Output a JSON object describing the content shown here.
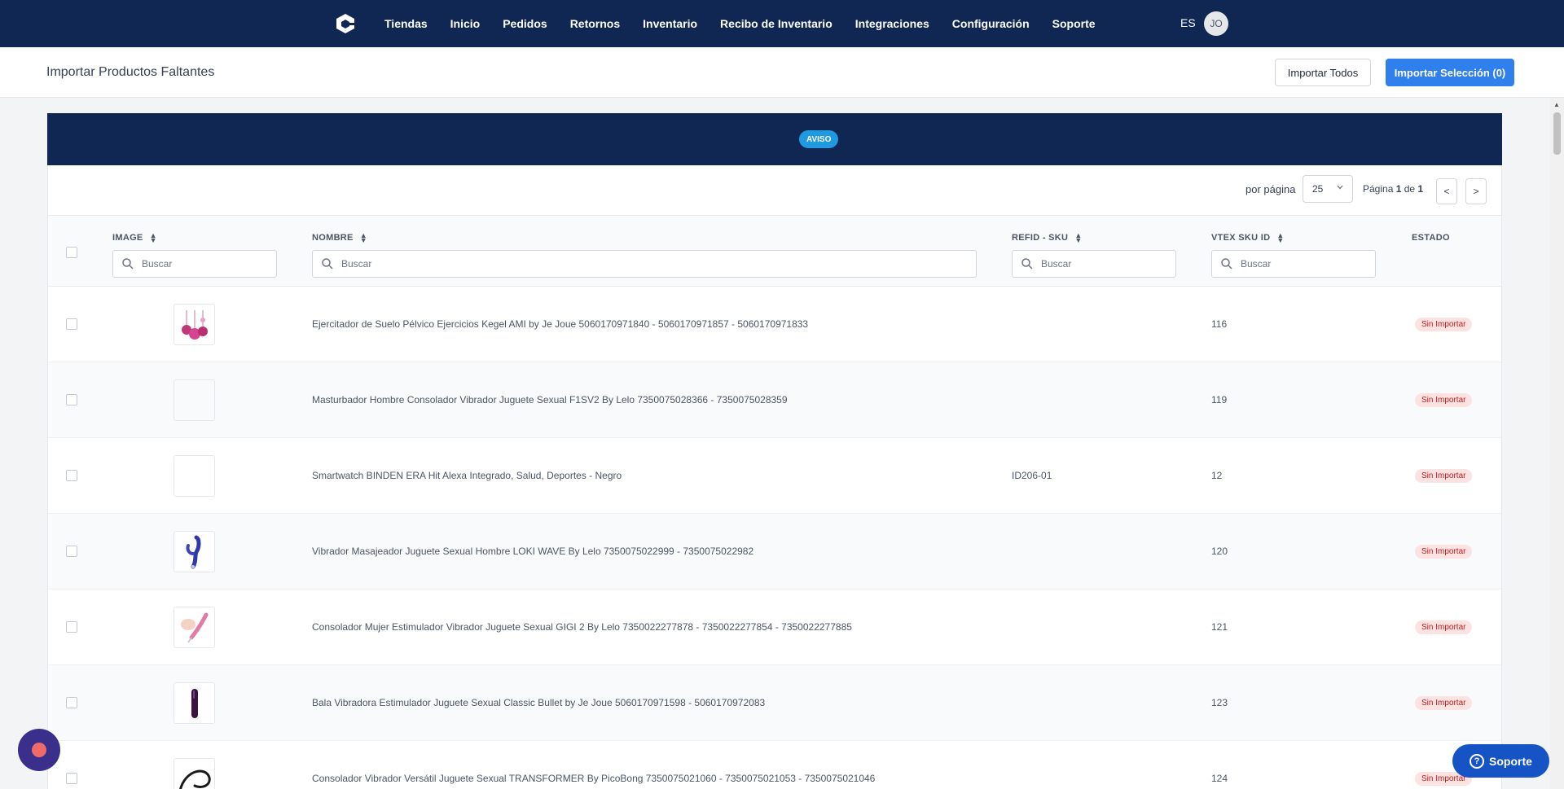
{
  "nav": {
    "links": [
      "Tiendas",
      "Inicio",
      "Pedidos",
      "Retornos",
      "Inventario",
      "Recibo de Inventario",
      "Integraciones",
      "Configuración",
      "Soporte"
    ],
    "lang": "ES",
    "avatar_initials": "JO"
  },
  "header": {
    "title": "Importar Productos Faltantes",
    "import_all_label": "Importar Todos",
    "import_selection_label": "Importar Selección (0)"
  },
  "banner": {
    "badge": "AVISO"
  },
  "pagination": {
    "per_page_label": "por página",
    "per_page_value": "25",
    "page_word": "Página",
    "current_page": "1",
    "of_word": "de",
    "total_pages": "1",
    "prev_label": "<",
    "next_label": ">"
  },
  "table": {
    "columns": {
      "image": "IMAGE",
      "name": "NOMBRE",
      "refid": "REFID - SKU",
      "vtex": "VTEX SKU ID",
      "status": "ESTADO"
    },
    "search_placeholder": "Buscar",
    "rows": [
      {
        "name": "Ejercitador de Suelo Pélvico Ejercicios Kegel AMI by Je Joue 5060170971840 - 5060170971857 - 5060170971833",
        "refid": "",
        "vtex": "116",
        "status": "Sin Importar",
        "image": "kegel-balls-product-image"
      },
      {
        "name": "Masturbador Hombre Consolador Vibrador Juguete Sexual F1SV2 By Lelo 7350075028366 - 7350075028359",
        "refid": "",
        "vtex": "119",
        "status": "Sin Importar",
        "image": "empty-placeholder"
      },
      {
        "name": "Smartwatch BINDEN ERA Hit Alexa Integrado, Salud, Deportes - Negro",
        "refid": "ID206-01",
        "vtex": "12",
        "status": "Sin Importar",
        "image": "empty-placeholder"
      },
      {
        "name": "Vibrador Masajeador Juguete Sexual Hombre LOKI WAVE By Lelo 7350075022999 - 7350075022982",
        "refid": "",
        "vtex": "120",
        "status": "Sin Importar",
        "image": "blue-massager-product-image"
      },
      {
        "name": "Consolador Mujer Estimulador Vibrador Juguete Sexual GIGI 2 By Lelo 7350022277878 - 7350022277854 - 7350022277885",
        "refid": "",
        "vtex": "121",
        "status": "Sin Importar",
        "image": "pink-vibrator-product-image"
      },
      {
        "name": "Bala Vibradora Estimulador Juguete Sexual Classic Bullet by Je Joue 5060170971598 - 5060170972083",
        "refid": "",
        "vtex": "123",
        "status": "Sin Importar",
        "image": "purple-bullet-product-image"
      },
      {
        "name": "Consolador Vibrador Versátil Juguete Sexual TRANSFORMER By PicoBong 7350075021060 - 7350075021053 - 7350075021046",
        "refid": "",
        "vtex": "124",
        "status": "Sin Importar",
        "image": "black-transformer-product-image"
      }
    ]
  },
  "support": {
    "label": "Soporte"
  },
  "colors": {
    "navy": "#0f2752",
    "primary": "#2f7fec",
    "badge_bg": "#fde2e2",
    "badge_text": "#b91c1c",
    "aviso": "#1f9ae0"
  }
}
